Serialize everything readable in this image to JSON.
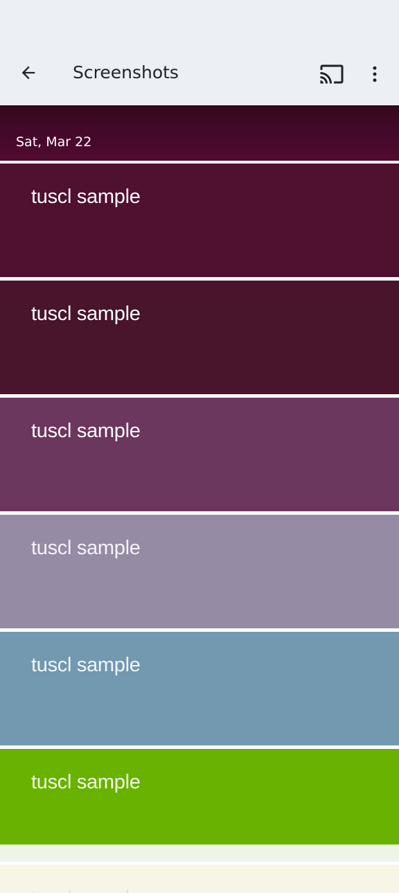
{
  "app_bar": {
    "title": "Screenshots",
    "back_icon": "arrow-left-icon",
    "cast_icon": "cast-icon",
    "more_icon": "more-vertical-icon",
    "background": "#ecf0f4"
  },
  "date_header": {
    "label": "Sat, Mar 22",
    "color": "#44092a"
  },
  "tiles": [
    {
      "label": "tuscl sample",
      "color": "#501131",
      "text_color": "#ffffff"
    },
    {
      "label": "tuscl sample",
      "color": "#48152d",
      "text_color": "#ffffff"
    },
    {
      "label": "tuscl sample",
      "color": "#6c375e",
      "text_color": "#ffffff"
    },
    {
      "label": "tuscl sample",
      "color": "#968ba4",
      "text_color": "#f6f2fa"
    },
    {
      "label": "tuscl sample",
      "color": "#7299b0",
      "text_color": "#f2f6fa"
    },
    {
      "label": "tuscl sample",
      "color": "#69b200",
      "text_color": "#f4fbe6"
    },
    {
      "label": "tuscl sample",
      "color": "#f7f6e6",
      "text_color": "#e8e6cc"
    }
  ]
}
